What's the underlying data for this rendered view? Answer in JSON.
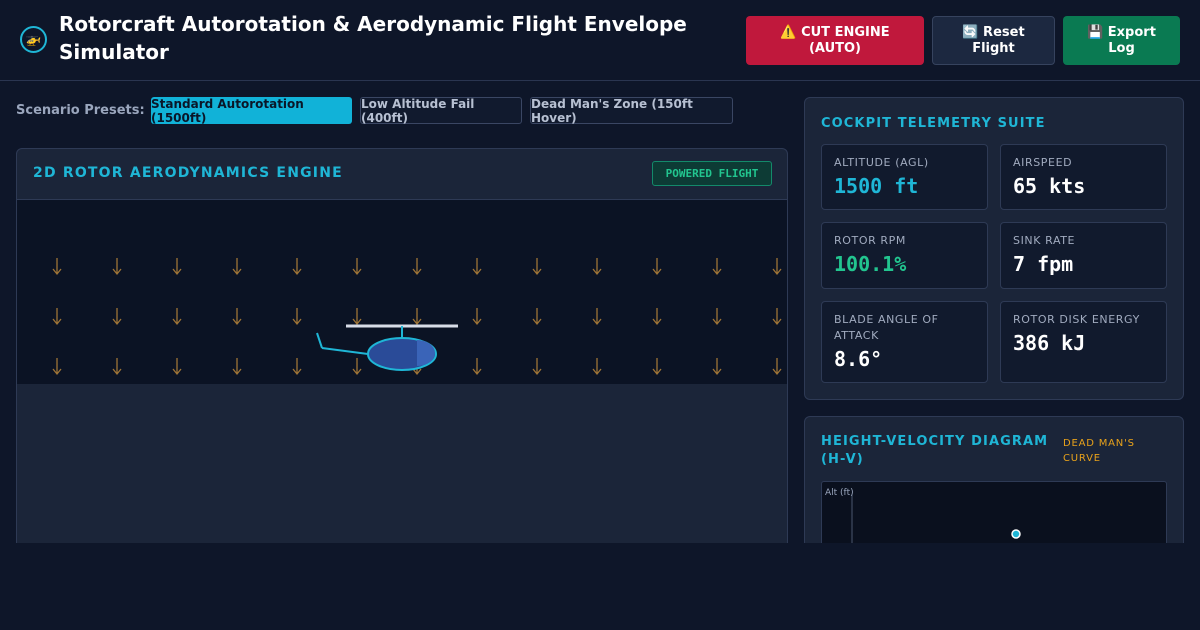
{
  "header": {
    "logo_icon": "helicopter-icon",
    "title": "Rotorcraft Autorotation & Aerodynamic Flight Envelope Simulator",
    "buttons": {
      "cut_engine": "⚠️ CUT ENGINE (AUTO)",
      "reset": "🔄 Reset Flight",
      "export": "💾 Export Log"
    }
  },
  "presets": {
    "label": "Scenario Presets:",
    "items": [
      {
        "label": "Standard Autorotation (1500ft)",
        "active": true
      },
      {
        "label": "Low Altitude Fail (400ft)",
        "active": false
      },
      {
        "label": "Dead Man's Zone (150ft Hover)",
        "active": false
      }
    ]
  },
  "engine": {
    "title": "2D ROTOR AERODYNAMICS ENGINE",
    "status_badge": "POWERED FLIGHT"
  },
  "telemetry": {
    "title": "COCKPIT TELEMETRY SUITE",
    "cards": [
      {
        "label": "ALTITUDE (AGL)",
        "value": "1500 ft",
        "color": "#1fb6d6"
      },
      {
        "label": "AIRSPEED",
        "value": "65 kts",
        "color": "#ffffff"
      },
      {
        "label": "ROTOR RPM",
        "value": "100.1%",
        "color": "#22c58f"
      },
      {
        "label": "SINK RATE",
        "value": "7 fpm",
        "color": "#ffffff"
      },
      {
        "label": "BLADE ANGLE OF ATTACK",
        "value": "8.6°",
        "color": "#ffffff"
      },
      {
        "label": "ROTOR DISK ENERGY",
        "value": "386 kJ",
        "color": "#ffffff"
      }
    ]
  },
  "hv": {
    "title": "HEIGHT-VELOCITY DIAGRAM (H-V)",
    "note": "DEAD MAN'S CURVE",
    "y_axis_label": "Alt (ft)"
  },
  "colors": {
    "accent": "#1fb6d6",
    "danger": "#c0183c",
    "success": "#0a7a52",
    "warning": "#e8a21b",
    "downwash_arrow": "#b8863b"
  }
}
